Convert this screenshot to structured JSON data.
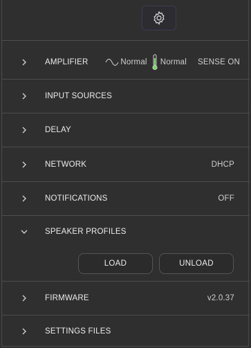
{
  "header": {
    "settings_icon": "gear-icon"
  },
  "sections": {
    "amplifier": {
      "label": "AMPLIFIER",
      "signal_status": "Normal",
      "temperature_status": "Normal",
      "sense": "SENSE ON",
      "temperature_color": "#7fd36b"
    },
    "input_sources": {
      "label": "INPUT SOURCES"
    },
    "delay": {
      "label": "DELAY"
    },
    "network": {
      "label": "NETWORK",
      "value": "DHCP"
    },
    "notifications": {
      "label": "NOTIFICATIONS",
      "value": "OFF"
    },
    "speaker_profiles": {
      "label": "SPEAKER PROFILES",
      "load_label": "LOAD",
      "unload_label": "UNLOAD"
    },
    "firmware": {
      "label": "FIRMWARE",
      "value": "v2.0.37"
    },
    "settings_files": {
      "label": "SETTINGS FILES"
    }
  },
  "icons": {
    "collapsed": "chevron-right-icon",
    "expanded": "chevron-down-icon",
    "signal": "sine-wave-icon",
    "temperature": "thermometer-icon"
  }
}
